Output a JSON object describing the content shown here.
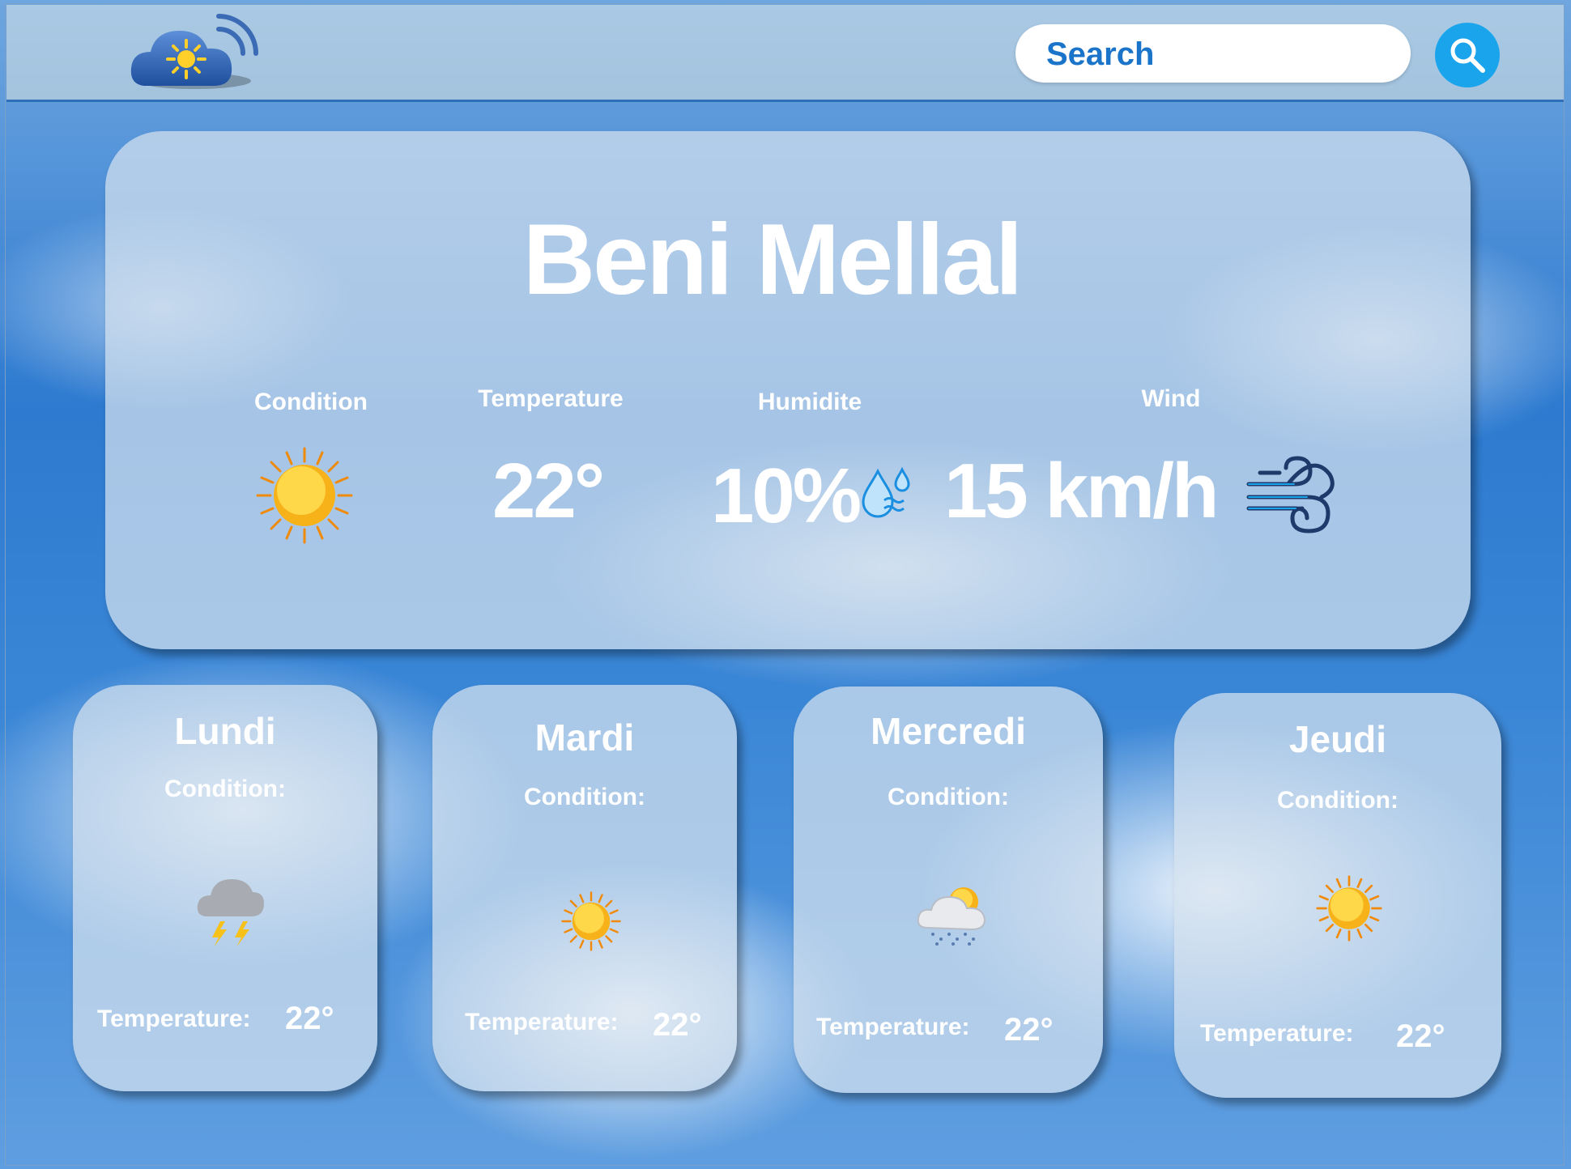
{
  "header": {
    "search_placeholder": "Search",
    "logo_icon": "cloud-sun-wifi-icon",
    "search_icon": "magnifier-icon"
  },
  "current": {
    "city": "Beni Mellal",
    "condition_label": "Condition",
    "condition_icon": "sun-icon",
    "temperature_label": "Temperature",
    "temperature": "22°",
    "humidity_label": "Humidite",
    "humidity": "10%",
    "humidity_icon": "water-drops-icon",
    "wind_label": "Wind",
    "wind": "15 km/h",
    "wind_icon": "wind-icon"
  },
  "forecast": [
    {
      "day": "Lundi",
      "condition_label": "Condition:",
      "icon": "thunderstorm-icon",
      "temp_label": "Temperature:",
      "temp": "22°"
    },
    {
      "day": "Mardi",
      "condition_label": "Condition:",
      "icon": "sun-icon",
      "temp_label": "Temperature:",
      "temp": "22°"
    },
    {
      "day": "Mercredi",
      "condition_label": "Condition:",
      "icon": "sun-rain-cloud-icon",
      "temp_label": "Temperature:",
      "temp": "22°"
    },
    {
      "day": "Jeudi",
      "condition_label": "Condition:",
      "icon": "sun-icon",
      "temp_label": "Temperature:",
      "temp": "22°"
    }
  ],
  "colors": {
    "accent": "#1aa4ec",
    "search_text": "#1a74c9",
    "sun": "#f7b21a"
  }
}
